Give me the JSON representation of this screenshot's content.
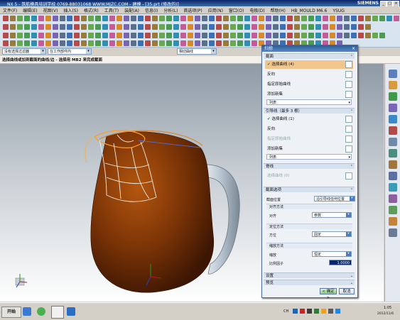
{
  "window": {
    "title": "NX 5 - 筑航模具培训学校 0769-88031068 WWW.MJZC.COM - 建模 - [35.prt (修改的)]",
    "brand": "SIEMENS"
  },
  "menu": [
    "文件(F)",
    "编辑(E)",
    "视图(V)",
    "插入(S)",
    "格式(R)",
    "工具(T)",
    "装配(A)",
    "信息(I)",
    "分析(L)",
    "首选项(P)",
    "应用(N)",
    "窗口(O)",
    "电极(D)",
    "帮助(H)",
    "HB_MOULD M6.6",
    "YSUG"
  ],
  "selection_bar": {
    "filter": "没有选择过滤器",
    "scope": "在工作部件内",
    "snap": "相切曲线"
  },
  "cue_line": "选择曲线或加到截面的曲线/边 - 选择用 MB2 来完成截面",
  "dialog": {
    "title": "扫掠",
    "section": {
      "header": "截面",
      "select_curve": "选择曲线 (4)",
      "reverse": "反向",
      "specify_origin": "指定原始曲线",
      "add_new_set": "添加新集",
      "list": "列表"
    },
    "guides": {
      "header": "引导线（最多 3 根）",
      "select_curve": "选择曲线 (1)",
      "reverse": "反向",
      "specify_origin": "指定原始曲线",
      "add_new_set": "添加新集",
      "list": "列表"
    },
    "spine": {
      "header": "脊线",
      "select_curve": "选择曲线 (0)"
    },
    "options": {
      "header": "截面选项",
      "position_label": "截面位置",
      "position_value": "沿引导线任何位置",
      "alignment_header": "对齐方法",
      "alignment_label": "对齐",
      "alignment_value": "参数",
      "orientation_header": "定位方法",
      "orientation_label": "方位",
      "orientation_value": "固定",
      "scaling_header": "缩放方法",
      "scaling_label": "缩放",
      "scaling_value": "恒定",
      "ratio_label": "比例因子",
      "ratio_value": "1.0000"
    },
    "settings": "设置",
    "preview": "预览",
    "ok": "< 确定 >",
    "cancel": "取消"
  },
  "taskbar": {
    "start": "开始",
    "ime": "CH",
    "time": "1:05",
    "date": "2012/11/6"
  },
  "colors": {
    "teapot_body": "#7a3306",
    "handle": "#b7c4cf",
    "active_row": "#f2c58d"
  }
}
